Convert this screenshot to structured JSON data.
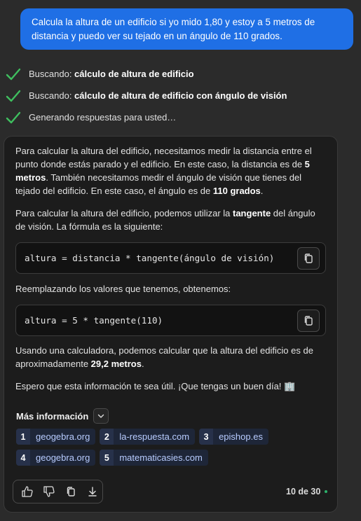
{
  "user_message": "Calcula la altura de un edificio si yo mido 1,80 y estoy a 5 metros de distancia y puedo ver su tejado en un ángulo de 110 grados.",
  "steps": [
    {
      "prefix": "Buscando: ",
      "query": "cálculo de altura de edificio",
      "icon": "check-icon"
    },
    {
      "prefix": "Buscando: ",
      "query": "cálculo de altura de edificio con ángulo de visión",
      "icon": "check-icon"
    },
    {
      "prefix": "",
      "query": "",
      "text": "Generando respuestas para usted…",
      "icon": "check-icon"
    }
  ],
  "answer": {
    "p1": [
      "Para calcular la altura del edificio, necesitamos medir la distancia entre el punto donde estás parado y el edificio. En este caso, la distancia es de ",
      "5 metros",
      ". También necesitamos medir el ángulo de visión que tienes del tejado del edificio. En este caso, el ángulo es de ",
      "110 grados",
      "."
    ],
    "p2": [
      "Para calcular la altura del edificio, podemos utilizar la ",
      "tangente",
      " del ángulo de visión. La fórmula es la siguiente:"
    ],
    "code1": "altura = distancia * tangente(ángulo de visión)",
    "p3": "Reemplazando los valores que tenemos, obtenemos:",
    "code2": "altura = 5 * tangente(110)",
    "p4": [
      "Usando una calculadora, podemos calcular que la altura del edificio es de aproximadamente ",
      "29,2 metros",
      "."
    ],
    "p5": "Espero que esta información te sea útil. ¡Que tengas un buen día! 🏢"
  },
  "more_info": {
    "label": "Más información",
    "icon": "chevron-down-icon"
  },
  "references": [
    {
      "num": "1",
      "label": "geogebra.org"
    },
    {
      "num": "2",
      "label": "la-respuesta.com"
    },
    {
      "num": "3",
      "label": "epishop.es"
    },
    {
      "num": "4",
      "label": "geogebra.org"
    },
    {
      "num": "5",
      "label": "matematicasies.com"
    }
  ],
  "actions": [
    "thumbs-up-icon",
    "thumbs-down-icon",
    "copy-icon",
    "download-icon"
  ],
  "pager": {
    "text": "10 de 30",
    "status_color": "#2bb36b"
  },
  "colors": {
    "accent": "#1f6fe5",
    "check": "#3fbf5f"
  }
}
